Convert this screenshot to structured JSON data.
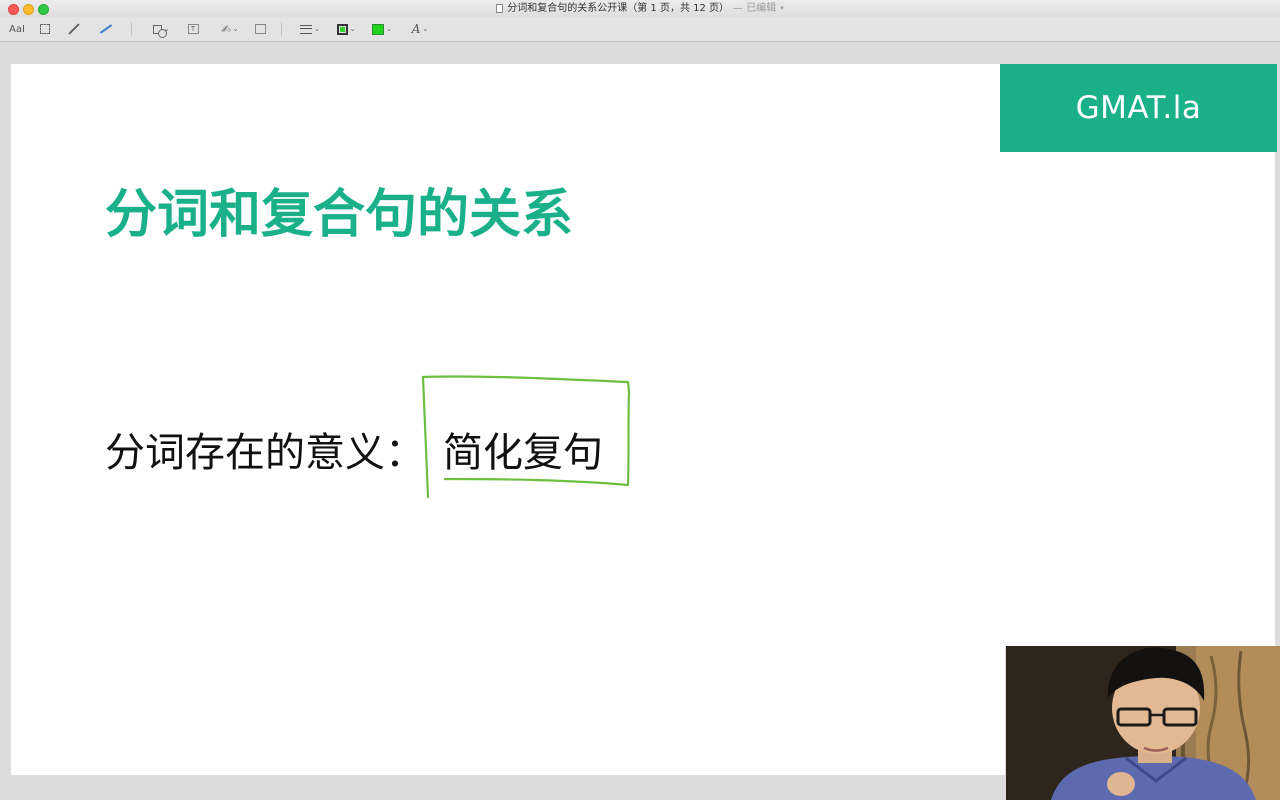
{
  "window": {
    "title": "分词和复合句的关系公开课（第 1 页，共 12 页）",
    "edited_label": "— 已编辑"
  },
  "toolbar": {
    "items": [
      {
        "name": "text-style-icon",
        "label": "AaI"
      },
      {
        "name": "rectangle-select-icon"
      },
      {
        "name": "sketch-pen-icon"
      },
      {
        "name": "draw-icon"
      },
      {
        "name": "shapes-icon"
      },
      {
        "name": "text-box-icon",
        "label": "T"
      },
      {
        "name": "sign-icon"
      },
      {
        "name": "note-icon"
      },
      {
        "name": "shape-style-icon"
      },
      {
        "name": "border-color-icon"
      },
      {
        "name": "fill-color-icon"
      },
      {
        "name": "text-format-icon",
        "label": "A"
      }
    ],
    "colors": {
      "border": "#2fd02f",
      "fill": "#1fd31f"
    }
  },
  "slide": {
    "brand": "GMAT.la",
    "title": "分词和复合句的关系",
    "body_text": "分词存在的意义：",
    "answer_text": "简化复句",
    "accent_color": "#1ab08a",
    "annotation_color": "#6cbf3f"
  },
  "webcam": {
    "label": "presenter-video"
  }
}
